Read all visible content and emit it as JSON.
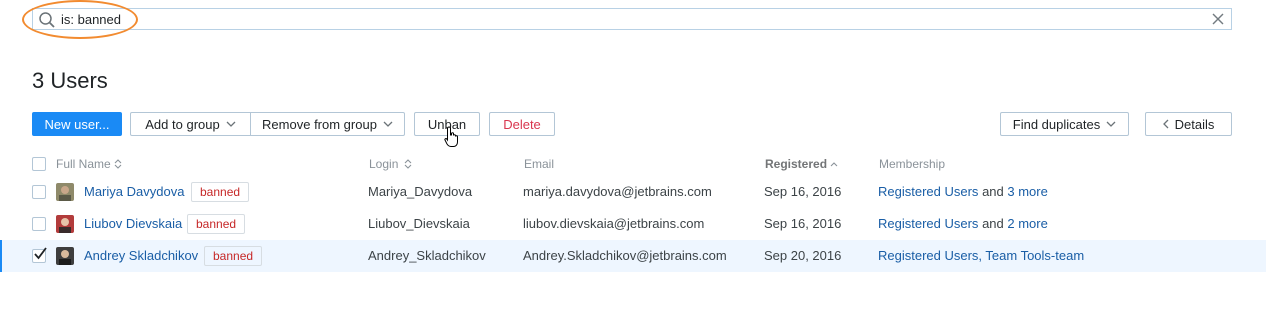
{
  "search": {
    "query": "is: banned"
  },
  "page_title": "3 Users",
  "toolbar": {
    "new_user": "New user...",
    "add_to_group": "Add to group",
    "remove_from_group": "Remove from group",
    "unban": "Unban",
    "delete": "Delete",
    "find_duplicates": "Find duplicates",
    "details": "Details"
  },
  "table": {
    "headers": {
      "full_name": "Full Name",
      "login": "Login",
      "email": "Email",
      "registered": "Registered",
      "membership": "Membership"
    },
    "rows": [
      {
        "name": "Mariya Davydova",
        "badge": "banned",
        "login": "Mariya_Davydova",
        "email": "mariya.davydova@jetbrains.com",
        "registered": "Sep 16, 2016",
        "membership_link": "Registered Users",
        "membership_and": "and",
        "membership_more": "3 more",
        "checked": false
      },
      {
        "name": "Liubov Dievskaia",
        "badge": "banned",
        "login": "Liubov_Dievskaia",
        "email": "liubov.dievskaia@jetbrains.com",
        "registered": "Sep 16, 2016",
        "membership_link": "Registered Users",
        "membership_and": "and",
        "membership_more": "2 more",
        "checked": false
      },
      {
        "name": "Andrey Skladchikov",
        "badge": "banned",
        "login": "Andrey_Skladchikov",
        "email": "Andrey.Skladchikov@jetbrains.com",
        "registered": "Sep 20, 2016",
        "membership_link": "Registered Users, Team Tools-team",
        "checked": true
      }
    ]
  },
  "icons": {
    "search": "search-icon",
    "clear": "close-icon",
    "chevron": "chevron-down-icon",
    "back": "chevron-left-icon",
    "sort": "sort-icon",
    "cursor": "hand-cursor-icon"
  },
  "colors": {
    "primary": "#1a8af5",
    "danger": "#d9364f",
    "badge": "#c62828",
    "link": "#1a5ea6",
    "highlight": "#f28b30",
    "selected_row": "#eef6ff"
  }
}
